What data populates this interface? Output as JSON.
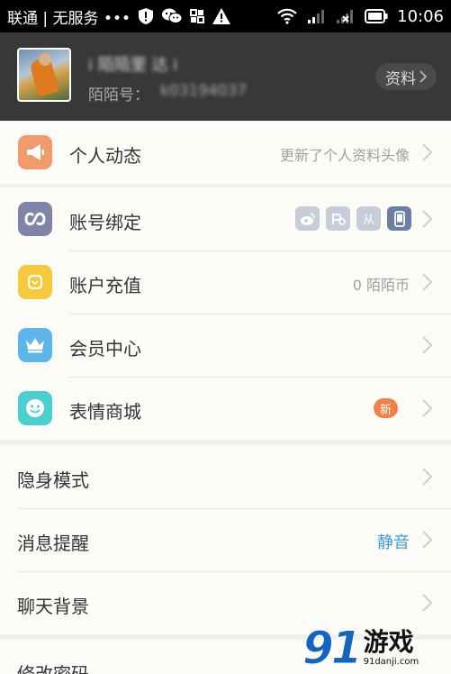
{
  "status_bar": {
    "carrier": "联通 | 无服务 •••",
    "time": "10:06"
  },
  "profile": {
    "name": "i 陌陌里 达 i",
    "id_label": "陌陌号：",
    "id_value": "k03194037",
    "details_button": "资料"
  },
  "sections": {
    "activity": {
      "label": "个人动态",
      "value": "更新了个人资料头像"
    },
    "account_binding": {
      "label": "账号绑定",
      "icons": [
        "weibo-icon",
        "pengyou-icon",
        "renren-icon",
        "phone-icon"
      ],
      "renren_text": "从"
    },
    "recharge": {
      "label": "账户充值",
      "value": "0 陌陌币"
    },
    "membership": {
      "label": "会员中心"
    },
    "sticker_store": {
      "label": "表情商城",
      "badge": "新"
    },
    "invisible_mode": {
      "label": "隐身模式"
    },
    "notifications": {
      "label": "消息提醒",
      "value": "静音"
    },
    "chat_background": {
      "label": "聊天背景"
    },
    "change_password": {
      "label": "修改密码"
    }
  },
  "watermark": {
    "number": "91",
    "text": "游戏",
    "url": "91danji.com"
  },
  "colors": {
    "activity_icon": "#f19a6c",
    "binding_icon": "#7f85a8",
    "recharge_icon": "#f7c93d",
    "membership_icon": "#5cb6ea",
    "sticker_icon": "#4ccfcf",
    "badge": "#f27f45",
    "accent_blue": "#3b9bd8"
  }
}
